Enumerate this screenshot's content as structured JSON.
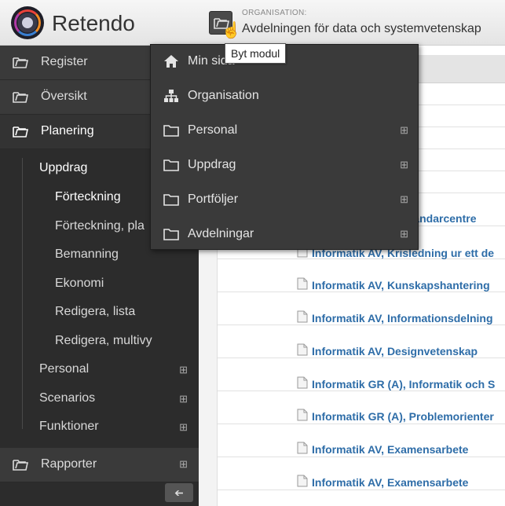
{
  "header": {
    "app_name": "Retendo",
    "org_label": "ORGANISATION:",
    "org_name": "Avdelningen för data och systemvetenskap",
    "tooltip": "Byt modul"
  },
  "sidebar": {
    "top": [
      {
        "label": "Register"
      },
      {
        "label": "Översikt"
      },
      {
        "label": "Planering"
      }
    ],
    "planering_sub": [
      {
        "label": "Uppdrag"
      },
      {
        "label": "Förteckning"
      },
      {
        "label": "Förteckning, pla"
      },
      {
        "label": "Bemanning"
      },
      {
        "label": "Ekonomi"
      },
      {
        "label": "Redigera, lista"
      },
      {
        "label": "Redigera, multivy"
      }
    ],
    "groups": [
      {
        "label": "Personal"
      },
      {
        "label": "Scenarios"
      },
      {
        "label": "Funktioner"
      }
    ],
    "rapporter": {
      "label": "Rapporter"
    },
    "plus": "⊞",
    "collapse": "➔"
  },
  "dropdown": {
    "items": [
      {
        "label": "Min sida",
        "icon": "home-icon"
      },
      {
        "label": "Organisation",
        "icon": "org-chart-icon"
      },
      {
        "label": "Personal",
        "icon": "folder-icon"
      },
      {
        "label": "Uppdrag",
        "icon": "folder-icon"
      },
      {
        "label": "Portföljer",
        "icon": "folder-icon"
      },
      {
        "label": "Avdelningar",
        "icon": "folder-icon"
      }
    ]
  },
  "content": {
    "courses": [
      {
        "label": "nvändarcentre"
      },
      {
        "label": "Informatik AV, Krisledning ur ett de"
      },
      {
        "label": "Informatik AV, Kunskapshantering"
      },
      {
        "label": "Informatik AV, Informationsdelning"
      },
      {
        "label": "Informatik AV, Designvetenskap"
      },
      {
        "label": "Informatik GR (A), Informatik och S"
      },
      {
        "label": "Informatik GR (A), Problemorienter"
      },
      {
        "label": "Informatik AV, Examensarbete"
      },
      {
        "label": "Informatik AV, Examensarbete"
      }
    ]
  }
}
